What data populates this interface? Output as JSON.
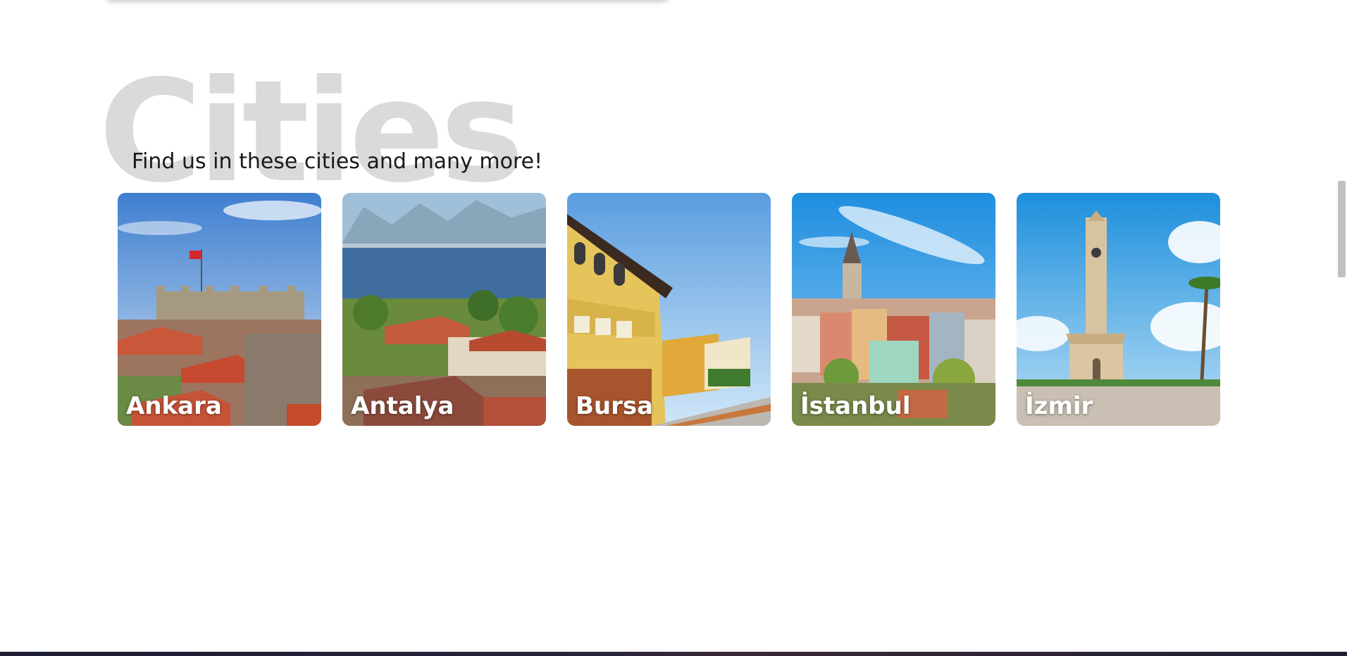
{
  "section": {
    "background_word": "Cities",
    "subtitle": "Find us in these cities and many more!"
  },
  "cities": [
    {
      "name": "Ankara"
    },
    {
      "name": "Antalya"
    },
    {
      "name": "Bursa"
    },
    {
      "name": "İstanbul"
    },
    {
      "name": "İzmir"
    }
  ],
  "colors": {
    "background_word": "#dadada",
    "subtitle_text": "#1a1a1a",
    "city_label": "#ffffff",
    "footer_band": "#1c1d33"
  }
}
